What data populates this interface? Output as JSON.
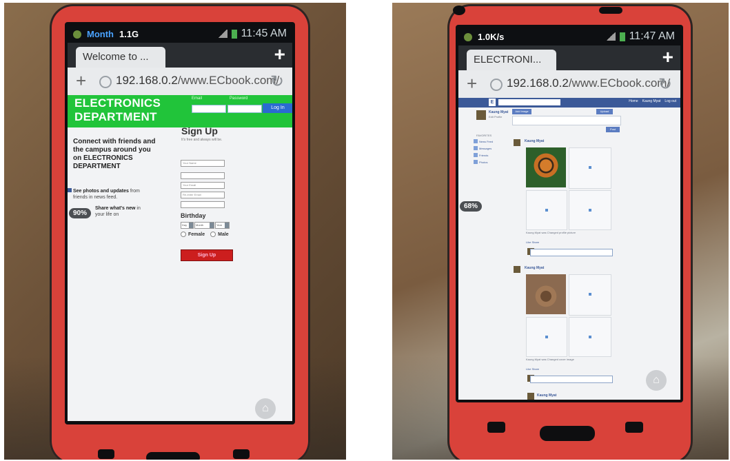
{
  "left_phone": {
    "status_bar": {
      "carrier_label": "Month",
      "data_usage": "1.1G",
      "time": "11:45 AM"
    },
    "tab": {
      "title": "Welcome to ...",
      "close_glyph": "×"
    },
    "new_tab_glyph": "+",
    "url_bar": {
      "host": "192.168.0.2",
      "path": "/www.ECbook.com/"
    },
    "header": {
      "title_line1": "ELECTRONICS",
      "title_line2": "DEPARTMENT",
      "email_label": "Email",
      "password_label": "Password",
      "login_button": "Log In"
    },
    "intro_text": "Connect with friends and the campus around you on ELECTRONICS DEPARTMENT",
    "features": [
      {
        "bold": "See photos and updates",
        "rest": " from friends in news feed."
      },
      {
        "bold": "Share what's new",
        "rest": " in your life on"
      }
    ],
    "signup": {
      "title": "Sign Up",
      "subtitle": "It's free and always will be.",
      "fields": [
        "Your Name",
        "",
        "Your Email",
        "Re-enter Email",
        ""
      ],
      "birthday_label": "Birthday",
      "birthday_selects": [
        "Day",
        "Month",
        "Year"
      ],
      "gender_options": [
        "Female",
        "Male"
      ],
      "signup_button": "Sign Up"
    },
    "zoom": "90%"
  },
  "right_phone": {
    "status_bar": {
      "speed": "1.0K/s",
      "time": "11:47 AM"
    },
    "tab": {
      "title": "ELECTRONI...",
      "close_glyph": "×"
    },
    "new_tab_glyph": "+",
    "url_bar": {
      "host": "192.168.0.2",
      "path": "/www.ECbook.com/"
    },
    "fb_nav": [
      "Home",
      "Kaung Myat",
      "Log out"
    ],
    "profile": {
      "name": "Kaung Myat",
      "sub": "Edit Profile"
    },
    "composer_tabs": [
      "Add Image",
      "Upload"
    ],
    "post_button": "Post",
    "favorites_label": "FAVORITES",
    "sidebar_items": [
      "News Feed",
      "Messages",
      "Friends",
      "Photos"
    ],
    "posts": [
      {
        "author": "Kaung Myat",
        "caption": "Kaung Myat was Changed profile picture",
        "actions": "Like Share"
      },
      {
        "author": "Kaung Myat",
        "caption": "Kaung Myat was Changed cover image",
        "actions": "Like Share"
      },
      {
        "author": "Kaung Myat"
      }
    ],
    "zoom": "68%"
  },
  "colors": {
    "phone_case": "#d9423a",
    "header_green": "#21c43a",
    "fb_blue": "#3b5998",
    "signup_red": "#cc1e1e"
  }
}
